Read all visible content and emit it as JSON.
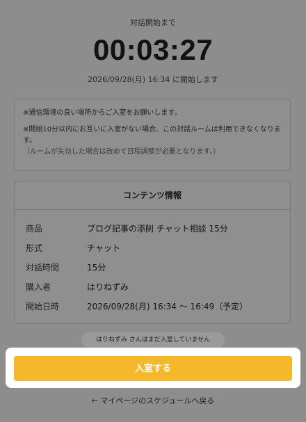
{
  "countdown": {
    "label": "対話開始まで",
    "time": "00:03:27",
    "start_info": "2026/09/28(月) 16:34 に開始します"
  },
  "notice": {
    "line1": "※通信環境の良い場所からご入室をお願いします。",
    "line2": "※開始10分以内にお互いに入室がない場合、この対話ルームは利用できなくなります。",
    "line3": "（ルームが失効した場合は改めて日程調整が必要となります。）"
  },
  "content_info": {
    "title": "コンテンツ情報",
    "rows": [
      {
        "key": "商品",
        "value": "ブログ記事の添削 チャット相談 15分"
      },
      {
        "key": "形式",
        "value": "チャット"
      },
      {
        "key": "対話時間",
        "value": "15分"
      },
      {
        "key": "購入者",
        "value": "はりねずみ"
      },
      {
        "key": "開始日時",
        "value": "2026/09/28(月) 16:34 〜 16:49（予定）"
      }
    ]
  },
  "status": {
    "text": "はりねずみ さんはまだ入室していません"
  },
  "actions": {
    "enter_label": "入室する",
    "back_label": "← マイページのスケジュールへ戻る"
  },
  "colors": {
    "accent": "#f6b82b",
    "overlay": "#8d8d8d"
  }
}
